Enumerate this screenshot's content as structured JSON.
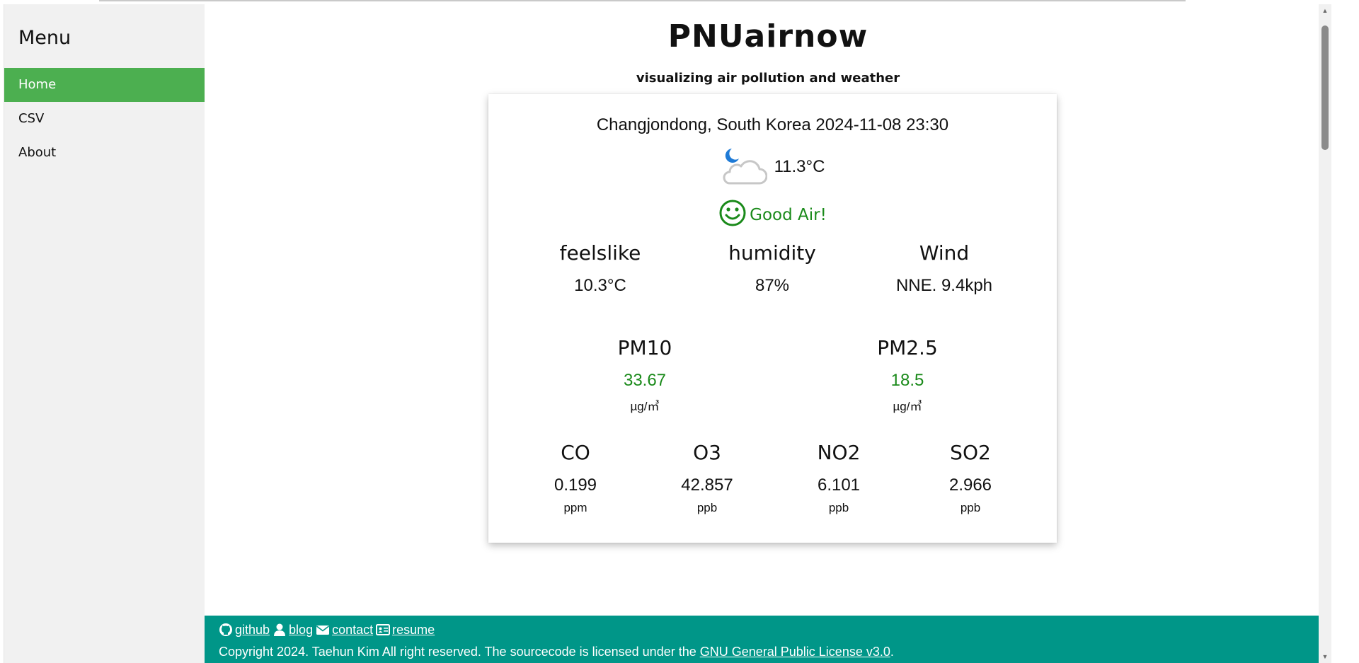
{
  "sidebar": {
    "title": "Menu",
    "items": [
      {
        "label": "Home"
      },
      {
        "label": "CSV"
      },
      {
        "label": "About"
      }
    ]
  },
  "header": {
    "title": "PNUairnow",
    "subtitle": "visualizing air pollution and weather"
  },
  "weather": {
    "location": "Changjondong, South Korea 2024-11-08 23:30",
    "icon": "moon-cloud-icon",
    "temperature": "11.3°C",
    "air_status": "Good Air!",
    "air_icon": "smiley-icon",
    "metrics": [
      {
        "label": "feelslike",
        "value": "10.3°C"
      },
      {
        "label": "humidity",
        "value": "87%"
      },
      {
        "label": "Wind",
        "value": "NNE. 9.4kph"
      }
    ],
    "particulates": [
      {
        "label": "PM10",
        "value": "33.67",
        "unit": "µg/㎥"
      },
      {
        "label": "PM2.5",
        "value": "18.5",
        "unit": "µg/㎥"
      }
    ],
    "gases": [
      {
        "label": "CO",
        "value": "0.199",
        "unit": "ppm"
      },
      {
        "label": "O3",
        "value": "42.857",
        "unit": "ppb"
      },
      {
        "label": "NO2",
        "value": "6.101",
        "unit": "ppb"
      },
      {
        "label": "SO2",
        "value": "2.966",
        "unit": "ppb"
      }
    ]
  },
  "footer": {
    "links": [
      {
        "label": "github",
        "icon": "github-icon"
      },
      {
        "label": "blog",
        "icon": "user-icon"
      },
      {
        "label": "contact",
        "icon": "envelope-icon"
      },
      {
        "label": "resume",
        "icon": "id-card-icon"
      }
    ],
    "copyright_prefix": "Copyright 2024. Taehun Kim All right reserved. The sourcecode is licensed under the ",
    "license_label": "GNU General Public License v3.0",
    "copyright_suffix": "."
  },
  "colors": {
    "accent": "#4caf50",
    "footer": "#009688",
    "good": "#1a8a1a"
  }
}
